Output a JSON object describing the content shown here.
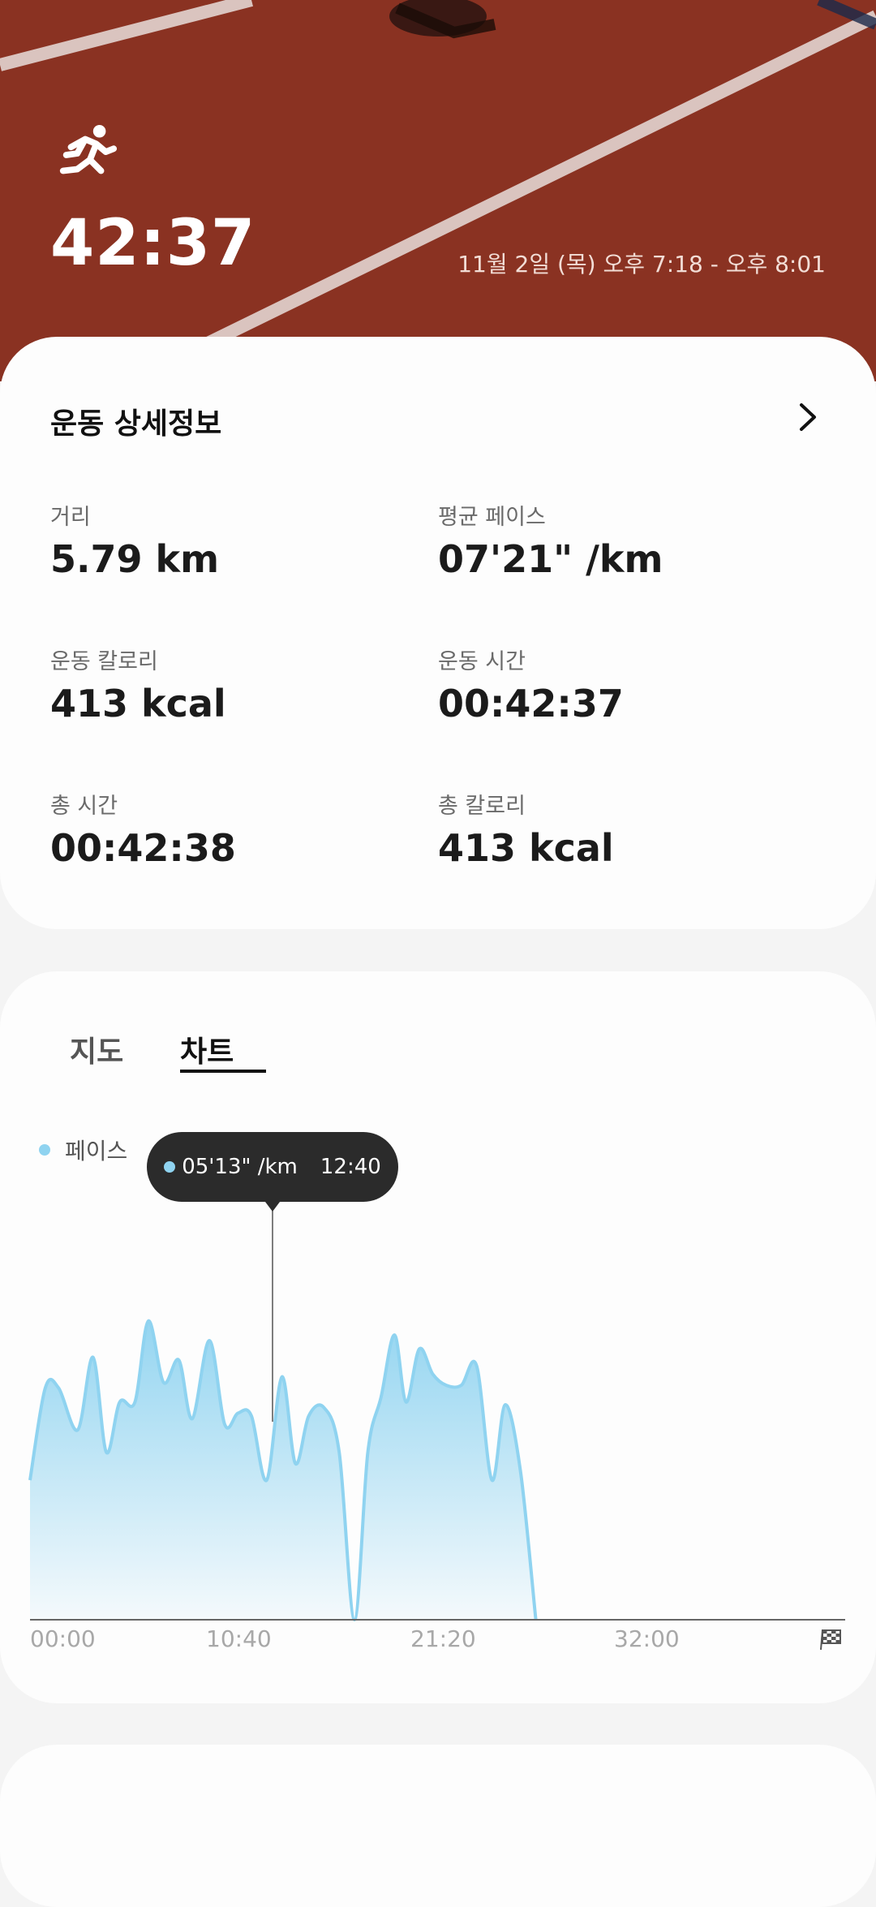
{
  "hero": {
    "duration": "42:37",
    "date_range": "11월 2일 (목) 오후 7:18 - 오후 8:01",
    "icon": "running-icon"
  },
  "details": {
    "title": "운동 상세정보",
    "stats": [
      {
        "label": "거리",
        "value": "5.79 km"
      },
      {
        "label": "평균 페이스",
        "value": "07'21\" /km"
      },
      {
        "label": "운동 칼로리",
        "value": "413 kcal"
      },
      {
        "label": "운동 시간",
        "value": "00:42:37"
      },
      {
        "label": "총 시간",
        "value": "00:42:38"
      },
      {
        "label": "총 칼로리",
        "value": "413 kcal"
      }
    ]
  },
  "tabs": {
    "map": "지도",
    "chart": "차트",
    "selected": "chart"
  },
  "legend": {
    "label": "페이스",
    "color": "#8fd3f0"
  },
  "tooltip": {
    "pace": "05'13\" /km",
    "time": "12:40"
  },
  "chart_data": {
    "type": "area",
    "x_ticks": [
      "00:00",
      "10:40",
      "21:20",
      "32:00"
    ],
    "x_max_minutes": 42.6,
    "series": [
      {
        "name": "페이스",
        "color": "#8fd3f0",
        "x": [
          0,
          0.8,
          1.5,
          2.5,
          3.3,
          4.0,
          4.7,
          5.5,
          6.2,
          7.0,
          7.8,
          8.5,
          9.4,
          10.2,
          10.9,
          11.6,
          12.4,
          13.2,
          13.9,
          14.6,
          15.4,
          16.2,
          17.0,
          17.7,
          18.4,
          19.1,
          19.7,
          20.4,
          21.1,
          21.8,
          22.6,
          23.4,
          24.2,
          24.9,
          25.7,
          26.5,
          27.3,
          28.1,
          28.9,
          29.7,
          30.5,
          31.2,
          32.0,
          32.6
        ],
        "values": [
          0.5,
          0.83,
          0.83,
          0.68,
          0.94,
          0.6,
          0.78,
          0.78,
          1.07,
          0.85,
          0.93,
          0.72,
          1.0,
          0.7,
          0.74,
          0.73,
          0.5,
          0.87,
          0.56,
          0.73,
          0.76,
          0.6,
          0.0,
          0.6,
          0.8,
          1.02,
          0.78,
          0.97,
          0.88,
          0.84,
          0.84,
          0.91,
          0.5,
          0.77,
          0.53,
          0.0,
          null,
          null,
          null,
          null,
          null,
          null,
          null,
          null
        ]
      }
    ]
  }
}
